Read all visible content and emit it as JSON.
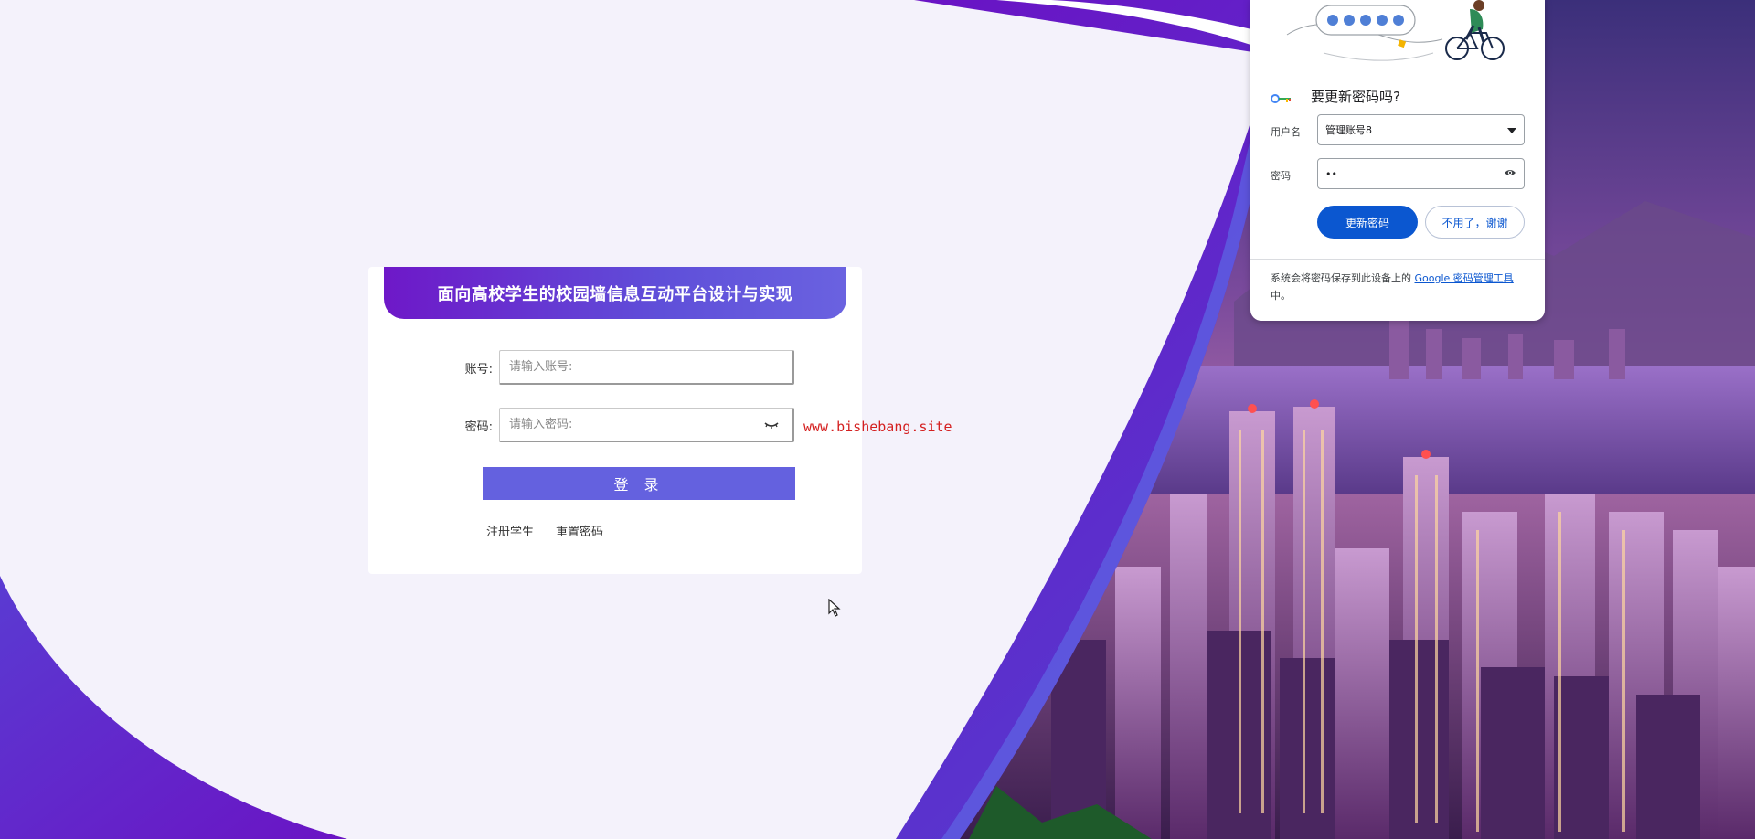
{
  "login": {
    "title": "面向高校学生的校园墙信息互动平台设计与实现",
    "account_label": "账号:",
    "account_placeholder": "请输入账号:",
    "password_label": "密码:",
    "password_placeholder": "请输入密码:",
    "login_button": "登 录",
    "register_link": "注册学生",
    "reset_link": "重置密码"
  },
  "watermark": "www.bishebang.site",
  "password_popup": {
    "title": "要更新密码吗?",
    "username_label": "用户名",
    "username_value": "管理账号8",
    "password_label": "密码",
    "password_value": "••",
    "update_button": "更新密码",
    "decline_button": "不用了，谢谢",
    "footer_text": "系统会将密码保存到此设备上的 ",
    "footer_link": "Google 密码管理工具",
    "footer_suffix": "中。"
  },
  "icons": {
    "eye_toggle": "eye-closed-icon",
    "visibility": "eye-icon",
    "dropdown": "dropdown-arrow-icon",
    "key": "key-icon",
    "cursor": "mouse-cursor-icon"
  },
  "colors": {
    "brand_purple": "#6e18c8",
    "button_purple": "#6461df",
    "google_blue": "#0b57d0",
    "watermark_red": "#d42020"
  }
}
